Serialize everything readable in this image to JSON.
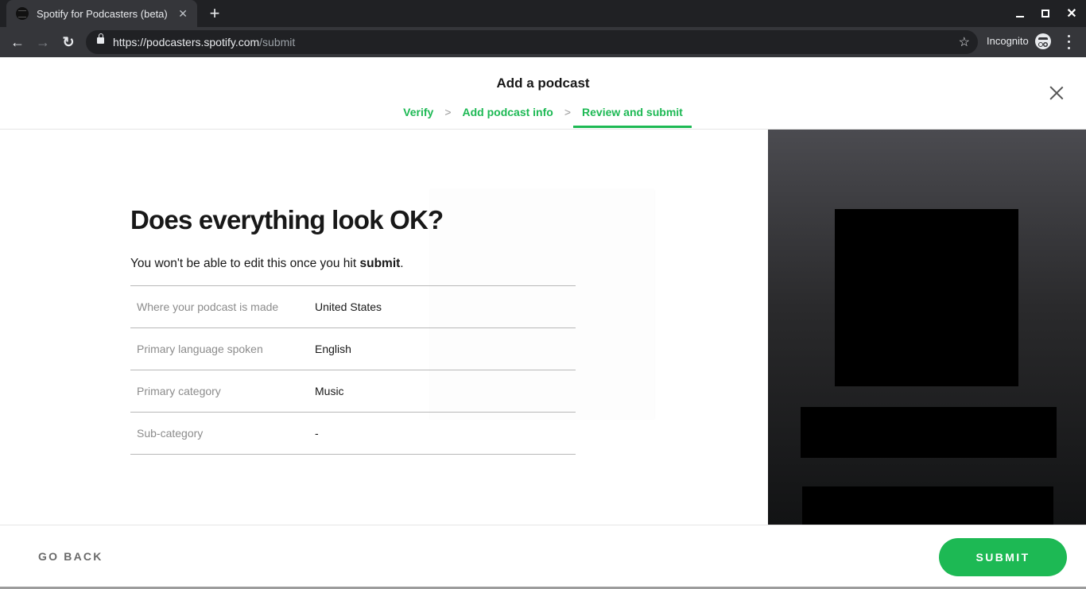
{
  "browser": {
    "tab_title": "Spotify for Podcasters (beta)",
    "tab_close": "✕",
    "new_tab": "+",
    "url_host": "https://podcasters.spotify.com",
    "url_path": "/submit",
    "incognito_label": "Incognito",
    "window_controls": {
      "minimize": "—",
      "restore": "❐",
      "close": "✕"
    },
    "nav": {
      "back": "←",
      "forward": "→",
      "reload": "↻",
      "bookmark": "☆"
    }
  },
  "header": {
    "title": "Add a podcast",
    "steps": [
      {
        "label": "Verify",
        "active": false
      },
      {
        "label": "Add podcast info",
        "active": false
      },
      {
        "label": "Review and submit",
        "active": true
      }
    ],
    "step_separator": ">"
  },
  "main": {
    "heading": "Does everything look OK?",
    "subtext_prefix": "You won't be able to edit this once you hit ",
    "subtext_bold": "submit",
    "subtext_suffix": ".",
    "rows": [
      {
        "label": "Where your podcast is made",
        "value": "United States"
      },
      {
        "label": "Primary language spoken",
        "value": "English"
      },
      {
        "label": "Primary category",
        "value": "Music"
      },
      {
        "label": "Sub-category",
        "value": "-"
      }
    ]
  },
  "footer": {
    "go_back_label": "GO BACK",
    "submit_label": "SUBMIT"
  },
  "colors": {
    "accent": "#1db954",
    "text": "#181818",
    "muted": "#8c8c8c"
  }
}
